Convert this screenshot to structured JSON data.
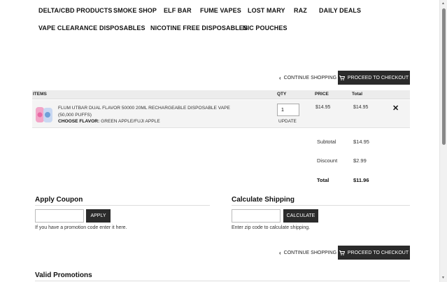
{
  "nav": {
    "row1": [
      "DELTA/CBD PRODUCTS",
      "SMOKE SHOP",
      "ELF BAR",
      "FUME VAPES",
      "LOST MARY",
      "RAZ",
      "DAILY DEALS"
    ],
    "row2": [
      "VAPE CLEARANCE",
      "DISPOSABLES",
      "NICOTINE FREE DISPOSABLES",
      "NIC POUCHES"
    ]
  },
  "actions": {
    "continue_label": "CONTINUE SHOPPING",
    "checkout_label": "PROCEED TO CHECKOUT"
  },
  "table": {
    "headers": {
      "items": "ITEMS",
      "qty": "QTY",
      "price": "PRICE",
      "total": "Total"
    },
    "rows": [
      {
        "name": "FLUM UTBAR DUAL FLAVOR 50000 20ML RECHARGEABLE DISPOSABLE VAPE (50,000 PUFFS)",
        "option_label": "CHOOSE FLAVOR:",
        "option_value": "GREEN APPLE/FUJI APPLE",
        "qty": "1",
        "update_label": "UPDATE",
        "price": "$14.95",
        "total": "$14.95"
      }
    ]
  },
  "summary": {
    "subtotal_label": "Subtotal",
    "subtotal": "$14.95",
    "discount_label": "Discount",
    "discount": "$2.99",
    "total_label": "Total",
    "total": "$11.96"
  },
  "coupon": {
    "title": "Apply Coupon",
    "button": "APPLY",
    "help": "If you have a promotion code enter it here."
  },
  "shipping": {
    "title": "Calculate Shipping",
    "button": "CALCULATE",
    "help": "Enter zip code to calculate shipping."
  },
  "promotions": {
    "title": "Valid Promotions"
  },
  "colors": {
    "dark_button": "#2b2b2b",
    "table_header": "#ececec",
    "row_bg": "#f4f4f4"
  },
  "icons": [
    "chevron-left-icon",
    "cart-icon",
    "remove-icon",
    "product-thumbnail"
  ]
}
